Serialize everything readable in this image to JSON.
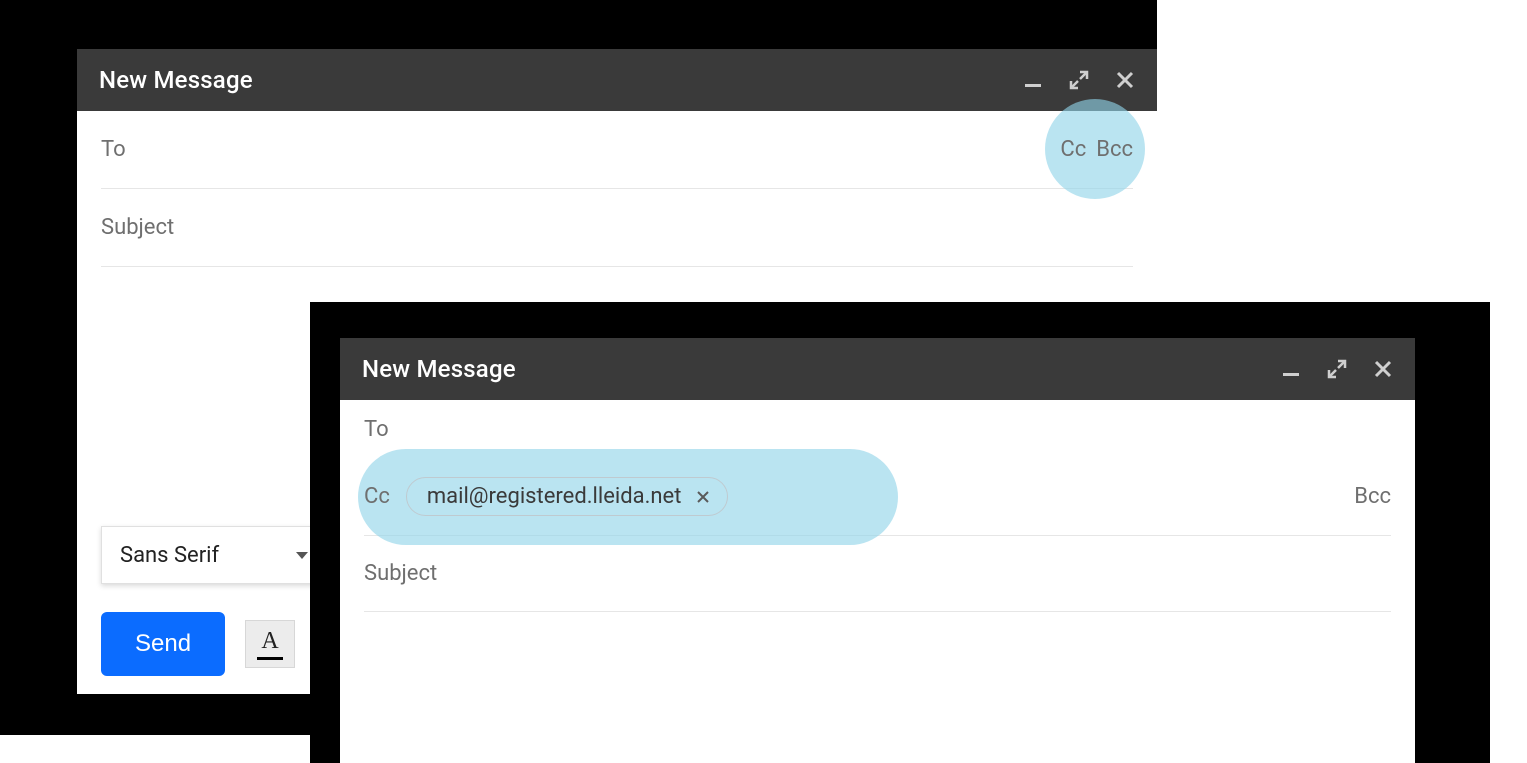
{
  "window1": {
    "title": "New Message",
    "to_label": "To",
    "cc_link": "Cc",
    "bcc_link": "Bcc",
    "subject_label": "Subject",
    "font_picker": "Sans Serif",
    "send_label": "Send",
    "format_letter": "A"
  },
  "window2": {
    "title": "New Message",
    "to_label": "To",
    "cc_label": "Cc",
    "cc_chip": "mail@registered.lleida.net",
    "bcc_link": "Bcc",
    "subject_label": "Subject"
  },
  "colors": {
    "highlight": "#8fd3e8",
    "send_button": "#0b6cff"
  }
}
